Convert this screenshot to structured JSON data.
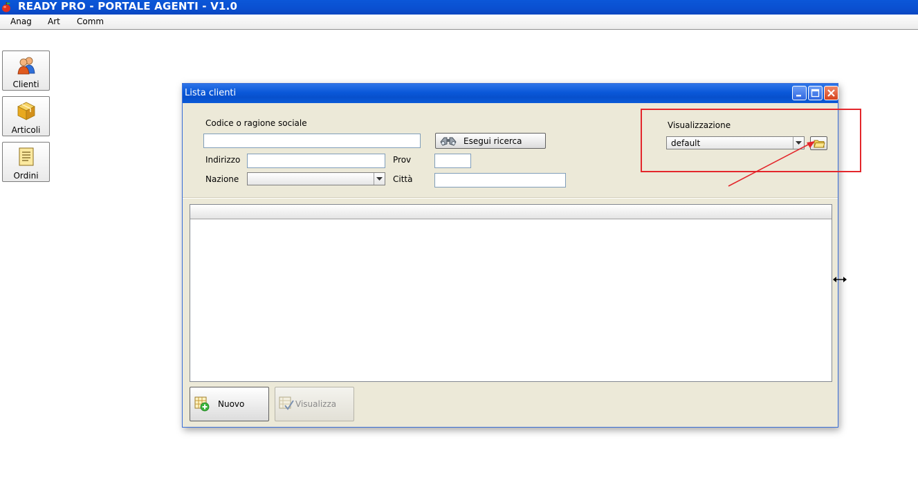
{
  "app": {
    "title": "READY PRO - PORTALE AGENTI - V1.0",
    "title_color": "#0a4fd0"
  },
  "menu": [
    "Anag",
    "Art",
    "Comm"
  ],
  "launcher": [
    {
      "label": "Clienti",
      "icon": "users-icon"
    },
    {
      "label": "Articoli",
      "icon": "box-icon"
    },
    {
      "label": "Ordini",
      "icon": "document-icon"
    }
  ],
  "window": {
    "title": "Lista clienti",
    "controls": [
      "minimize-icon",
      "maximize-icon",
      "close-icon"
    ]
  },
  "search": {
    "code_label": "Codice o ragione sociale",
    "code_value": "",
    "search_button": "Esegui ricerca",
    "address_label": "Indirizzo",
    "address_value": "",
    "prov_label": "Prov",
    "prov_value": "",
    "country_label": "Nazione",
    "country_value": "",
    "city_label": "Città",
    "city_value": ""
  },
  "view": {
    "label": "Visualizzazione",
    "selected": "default"
  },
  "actions": {
    "new_label": "Nuovo",
    "view_label": "Visualizza"
  },
  "annotation": {
    "highlight_color": "#e3262b"
  }
}
